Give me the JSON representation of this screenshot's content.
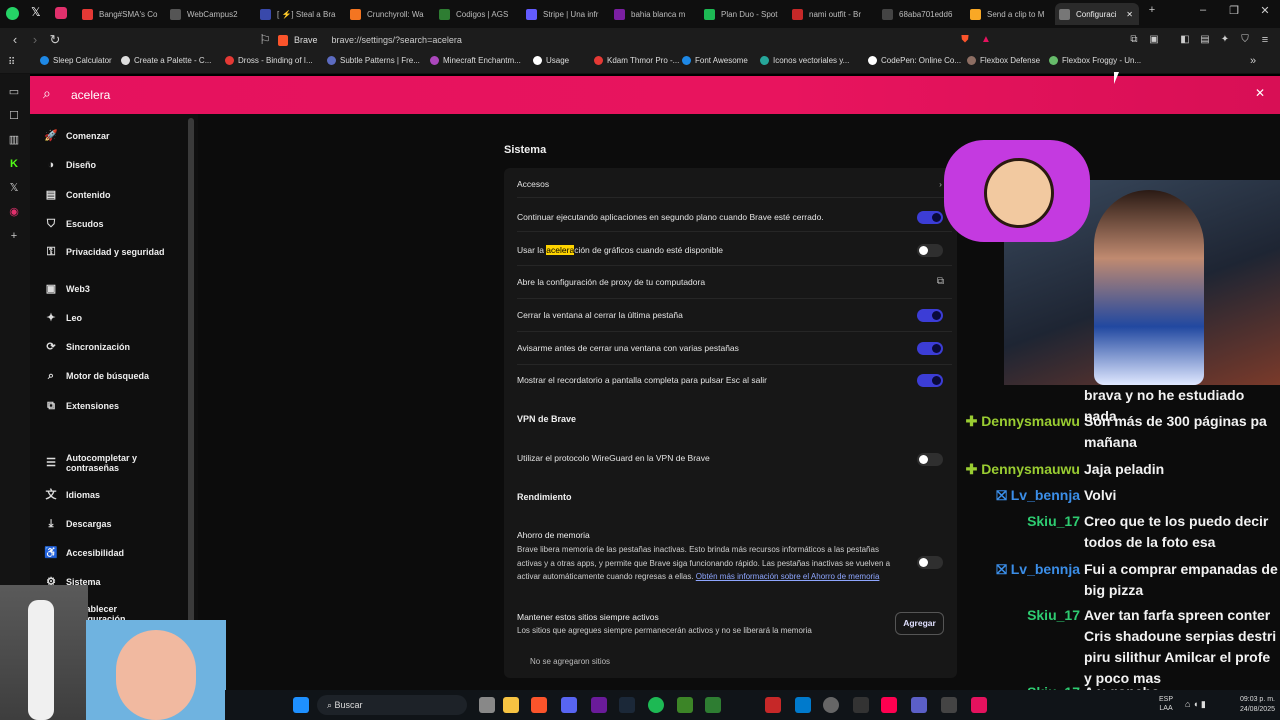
{
  "tabs": [
    {
      "label": "Bang#SMA's Co",
      "color": "#e53935"
    },
    {
      "label": "WebCampus2",
      "color": "#555"
    },
    {
      "label": "[ ⚡] Steal a Bra",
      "color": "#3949ab"
    },
    {
      "label": "Crunchyroll: Wa",
      "color": "#f47521"
    },
    {
      "label": "Codigos | AGS",
      "color": "#2e7d32"
    },
    {
      "label": "Stripe | Una infr",
      "color": "#635bff"
    },
    {
      "label": "bahia blanca m",
      "color": "#7b1fa2"
    },
    {
      "label": "Plan Duo - Spot",
      "color": "#1db954"
    },
    {
      "label": "nami outfit - Br",
      "color": "#c62828"
    },
    {
      "label": "68aba701edd6",
      "color": "#444"
    },
    {
      "label": "Send a clip to M",
      "color": "#f9a825"
    },
    {
      "label": "Configuraci",
      "color": "#777"
    }
  ],
  "address": {
    "brand": "Brave",
    "url": "brave://settings/?search=acelera"
  },
  "bookmarks": [
    {
      "label": "Sleep Calculator",
      "color": "#1e88e5"
    },
    {
      "label": "Create a Palette - C...",
      "color": "#ddd"
    },
    {
      "label": "Dross - Binding of I...",
      "color": "#e53935"
    },
    {
      "label": "Subtle Patterns | Fre...",
      "color": "#5c6bc0"
    },
    {
      "label": "Minecraft Enchantm...",
      "color": "#ab47bc"
    },
    {
      "label": "Usage",
      "color": "#fff"
    },
    {
      "label": "Kdam Thmor Pro -...",
      "color": "#e53935"
    },
    {
      "label": "Font Awesome",
      "color": "#1e88e5"
    },
    {
      "label": "Iconos vectoriales y...",
      "color": "#26a69a"
    },
    {
      "label": "CodePen: Online Co...",
      "color": "#fff"
    },
    {
      "label": "Flexbox Defense",
      "color": "#8d6e63"
    },
    {
      "label": "Flexbox Froggy - Un...",
      "color": "#66bb6a"
    }
  ],
  "search": {
    "query": "acelera"
  },
  "sidebar": {
    "items": [
      {
        "label": "Comenzar",
        "icon": "rocket-icon",
        "glyph": "🚀"
      },
      {
        "label": "Diseño",
        "icon": "palette-icon",
        "glyph": "◑"
      },
      {
        "label": "Contenido",
        "icon": "content-icon",
        "glyph": "▤"
      },
      {
        "label": "Escudos",
        "icon": "shield-icon",
        "glyph": "⛉"
      },
      {
        "label": "Privacidad y seguridad",
        "icon": "lock-icon",
        "glyph": "⚿"
      },
      {
        "label": "Web3",
        "icon": "wallet-icon",
        "glyph": "▣"
      },
      {
        "label": "Leo",
        "icon": "leo-icon",
        "glyph": "✦"
      },
      {
        "label": "Sincronización",
        "icon": "sync-icon",
        "glyph": "⟳"
      },
      {
        "label": "Motor de búsqueda",
        "icon": "search-icon",
        "glyph": "⌕"
      },
      {
        "label": "Extensiones",
        "icon": "puzzle-icon",
        "glyph": "⧉"
      },
      {
        "label": "Autocompletar y contraseñas",
        "icon": "list-icon",
        "glyph": "☰"
      },
      {
        "label": "Idiomas",
        "icon": "language-icon",
        "glyph": "文"
      },
      {
        "label": "Descargas",
        "icon": "download-icon",
        "glyph": "⤓"
      },
      {
        "label": "Accesibilidad",
        "icon": "accessibility-icon",
        "glyph": "♿"
      },
      {
        "label": "Sistema",
        "icon": "system-icon",
        "glyph": "⚙"
      },
      {
        "label": "Restablecer configuración",
        "icon": "reset-icon",
        "glyph": "↺"
      }
    ]
  },
  "settings": {
    "sistema_title": "Sistema",
    "accesos": "Accesos",
    "background_apps": "Continuar ejecutando aplicaciones en segundo plano cuando Brave esté cerrado.",
    "hw_pre": "Usar la ",
    "hw_hl": "acelera",
    "hw_post": "ción de gráficos cuando esté disponible",
    "proxy": "Abre la configuración de proxy de tu computadora",
    "close_window": "Cerrar la ventana al cerrar la última pestaña",
    "warn_close": "Avisarme antes de cerrar una ventana con varias pestañas",
    "fullscreen": "Mostrar el recordatorio a pantalla completa para pulsar Esc al salir",
    "vpn_title": "VPN de Brave",
    "wireguard": "Utilizar el protocolo WireGuard en la VPN de Brave",
    "perf_title": "Rendimiento",
    "memory_title": "Ahorro de memoria",
    "memory_desc": "Brave libera memoria de las pestañas inactivas. Esto brinda más recursos informáticos a las pestañas activas y a otras apps, y permite que Brave siga funcionando rápido. Las pestañas inactivas se vuelven a activar automáticamente cuando regresas a ellas. ",
    "memory_link": "Obtén más información sobre el Ahorro de memoria",
    "keep_title": "Mantener estos sitios siempre activos",
    "keep_desc": "Los sitios que agregues siempre permanecerán activos y no se liberará la memoria",
    "add_button": "Agregar",
    "no_sites": "No se agregaron sitios"
  },
  "toggles": {
    "background_apps": true,
    "hw_accel": false,
    "close_window": true,
    "warn_close": true,
    "fullscreen": true,
    "wireguard": false,
    "memory_saver": false
  },
  "chat": [
    {
      "user": "",
      "text": "brava y no he estudiado nada",
      "color": "#fff"
    },
    {
      "user": "Dennysmauwu",
      "text": "Son más de 300 páginas pa mañana",
      "color": "#9acd32",
      "badge": "✚"
    },
    {
      "user": "Dennysmauwu",
      "text": "Jaja peladin",
      "color": "#9acd32",
      "badge": "✚"
    },
    {
      "user": "Lv_bennja",
      "text": "Volvi",
      "color": "#3b8ee8",
      "badge": "⛝"
    },
    {
      "user": "Skiu_17",
      "text": "Creo que te los puedo decir todos de la foto esa",
      "color": "#2ecc71"
    },
    {
      "user": "Lv_bennja",
      "text": "Fui a comprar empanadas de big pizza",
      "color": "#3b8ee8",
      "badge": "⛝"
    },
    {
      "user": "Skiu_17",
      "text": "Aver tan farfa spreen conter Cris shadoune serpias destri piru silithur Amilcar el profe y poco mas",
      "color": "#2ecc71"
    },
    {
      "user": "Skiu_17",
      "text": "A y goncho",
      "color": "#2ecc71"
    }
  ],
  "taskbar": {
    "search": "Buscar",
    "lang1": "ESP",
    "lang2": "LAA",
    "time": "09:03 p. m.",
    "date": "24/08/2025"
  }
}
